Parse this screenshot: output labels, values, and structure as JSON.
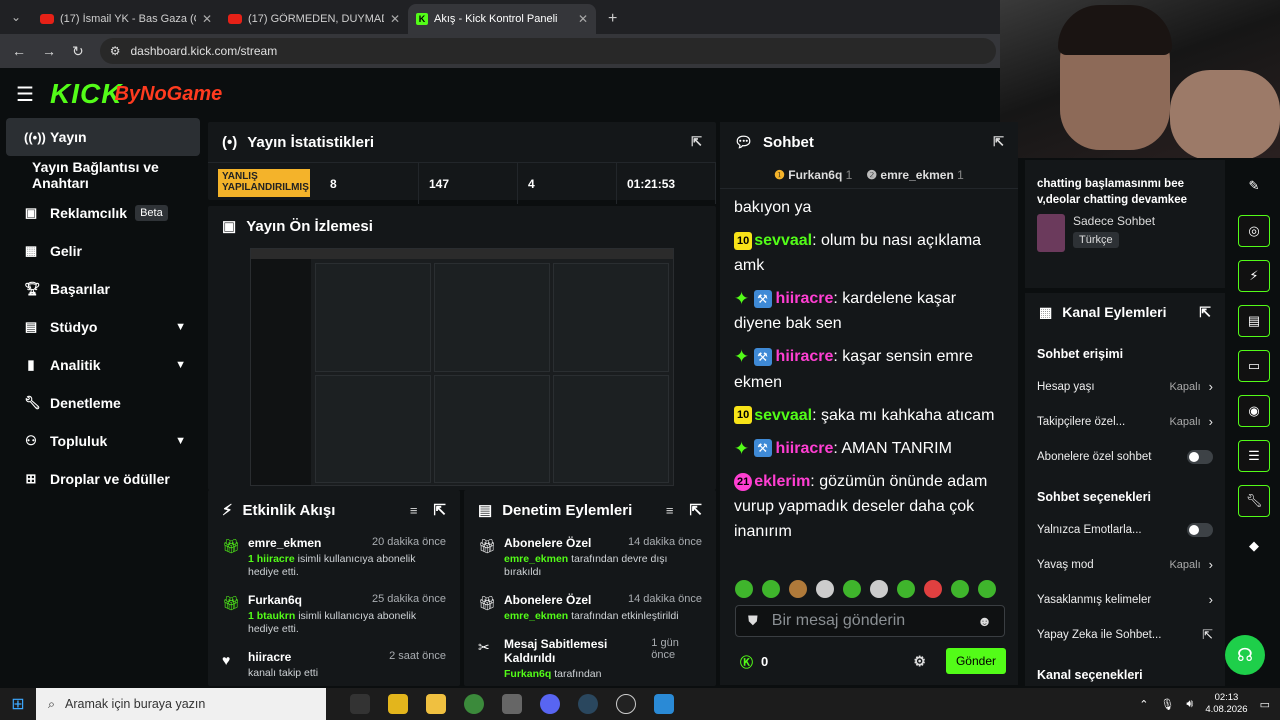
{
  "tabs": [
    {
      "title": "(17) İsmail YK - Bas Gaza (Offici",
      "kind": "youtube"
    },
    {
      "title": "(17) GÖRMEDEN, DUYMADAN",
      "kind": "youtube"
    },
    {
      "title": "Akış - Kick Kontrol Paneli",
      "kind": "kick"
    }
  ],
  "address": {
    "url": "dashboard.kick.com/stream"
  },
  "logo": {
    "main": "KICK",
    "overlay": "ByNoGame"
  },
  "sidebar": {
    "items": [
      {
        "label": "Yayın",
        "icon": "broadcast-icon"
      },
      {
        "label": "Yayın Bağlantısı ve Anahtarı"
      },
      {
        "label": "Reklamcılık",
        "badge": "Beta",
        "icon": "ad-icon"
      },
      {
        "label": "Gelir",
        "icon": "revenue-icon"
      },
      {
        "label": "Başarılar",
        "icon": "trophy-icon"
      },
      {
        "label": "Stüdyo",
        "icon": "studio-icon"
      },
      {
        "label": "Analitik",
        "icon": "analytics-icon"
      },
      {
        "label": "Denetleme",
        "icon": "wrench-icon"
      },
      {
        "label": "Topluluk",
        "icon": "community-icon"
      },
      {
        "label": "Droplar ve ödüller",
        "icon": "drops-icon"
      }
    ]
  },
  "stats": {
    "title": "Yayın İstatistikleri",
    "warning": "YANLIŞ YAPILANDIRILMIŞ",
    "values": [
      "8",
      "147",
      "4",
      "01:21:53"
    ]
  },
  "preview": {
    "title": "Yayın Ön İzlemesi"
  },
  "activity": {
    "title": "Etkinlik Akışı",
    "items": [
      {
        "name": "emre_ekmen",
        "time": "20 dakika önce",
        "desc_user": "1 hiiracre",
        "desc": "isimli kullanıcıya abonelik hediye etti."
      },
      {
        "name": "Furkan6q",
        "time": "25 dakika önce",
        "desc_user": "1 btaukrn",
        "desc": "isimli kullanıcıya abonelik hediye etti."
      },
      {
        "name": "hiiracre",
        "time": "2 saat önce",
        "desc": "kanalı takip etti"
      }
    ]
  },
  "moderation": {
    "title": "Denetim Eylemleri",
    "items": [
      {
        "name": "Abonelere Özel",
        "time": "14 dakika önce",
        "user": "emre_ekmen",
        "desc": "tarafından devre dışı bırakıldı"
      },
      {
        "name": "Abonelere Özel",
        "time": "14 dakika önce",
        "user": "emre_ekmen",
        "desc": "tarafından etkinleştirildi"
      },
      {
        "name": "Mesaj Sabitlemesi Kaldırıldı",
        "time": "1 gün önce",
        "user": "Furkan6q",
        "desc": "tarafından"
      }
    ]
  },
  "chat": {
    "title": "Sohbet",
    "pinned": [
      {
        "name": "Furkan6q",
        "count": "1"
      },
      {
        "name": "emre_ekmen",
        "count": "1"
      }
    ],
    "messages": [
      {
        "badge": "",
        "user": "",
        "text": "bakıyon ya"
      },
      {
        "badge": "10",
        "user": "sevvaal",
        "text": "olum bu nası açıklama amk"
      },
      {
        "badge": "star",
        "user": "hiiracre",
        "text": "kardelene kaşar diyene bak sen"
      },
      {
        "badge": "star",
        "user": "hiiracre",
        "text": "kaşar sensin emre ekmen"
      },
      {
        "badge": "10",
        "user": "sevvaal",
        "text": "şaka mı kahkaha atıcam"
      },
      {
        "badge": "star",
        "user": "hiiracre",
        "text": "AMAN TANRIM"
      },
      {
        "badge": "21",
        "user": "eklerim",
        "text": "gözümün önünde adam vurup yapmadık deseler daha çok inanırım"
      }
    ],
    "placeholder": "Bir mesaj gönderin",
    "points": "0",
    "send": "Gönder"
  },
  "info": {
    "title": "chatting başlamasınmı bee v,deolar chatting devamkee",
    "category": "Sadece Sohbet",
    "language": "Türkçe"
  },
  "channel_actions": {
    "title": "Kanal Eylemleri",
    "section1": "Sohbet erişimi",
    "rows1": [
      {
        "label": "Hesap yaşı",
        "value": "Kapalı",
        "type": "arrow"
      },
      {
        "label": "Takipçilere özel...",
        "value": "Kapalı",
        "type": "arrow"
      },
      {
        "label": "Abonelere özel sohbet",
        "value": "",
        "type": "toggle"
      }
    ],
    "section2": "Sohbet seçenekleri",
    "rows2": [
      {
        "label": "Yalnızca Emotlarla...",
        "value": "",
        "type": "toggle"
      },
      {
        "label": "Yavaş mod",
        "value": "Kapalı",
        "type": "arrow"
      },
      {
        "label": "Yasaklanmış kelimeler",
        "value": "",
        "type": "arrow"
      },
      {
        "label": "Yapay Zeka ile Sohbet...",
        "value": "",
        "type": "ext"
      }
    ],
    "section3": "Kanal seçenekleri"
  },
  "taskbar": {
    "search": "Aramak için buraya yazın",
    "time": "02:13",
    "date": "4.08.2026"
  },
  "colors": {
    "accent": "#53fc18",
    "bg": "#0b0e0f",
    "panel": "#141719",
    "pink": "#ff3fd2"
  }
}
